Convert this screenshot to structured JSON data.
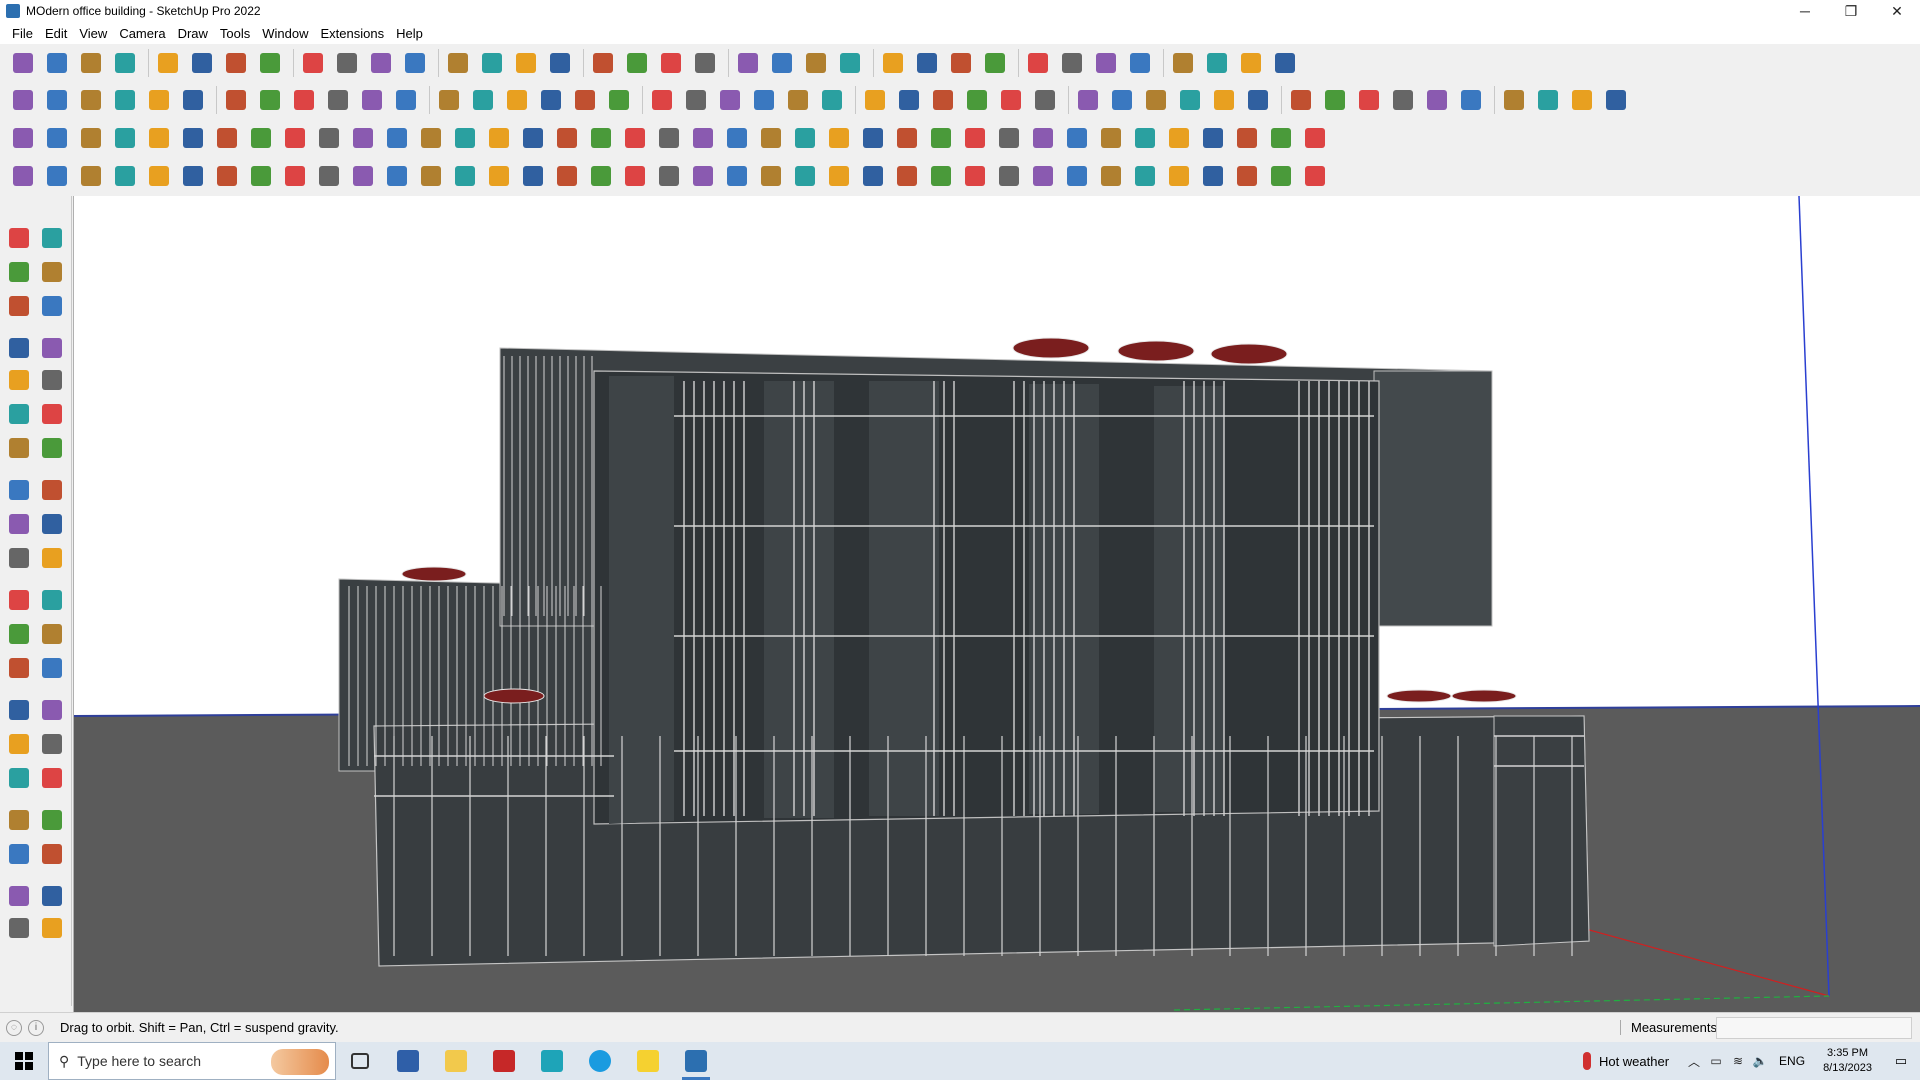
{
  "window": {
    "title": "MOdern office building - SketchUp Pro 2022",
    "minimize": "─",
    "maximize": "❐",
    "close": "✕"
  },
  "menu": [
    "File",
    "Edit",
    "View",
    "Camera",
    "Draw",
    "Tools",
    "Window",
    "Extensions",
    "Help"
  ],
  "status": {
    "hint": "Drag to orbit. Shift = Pan, Ctrl = suspend gravity.",
    "measurements_label": "Measurements",
    "measurements_value": ""
  },
  "taskbar": {
    "search_placeholder": "Type here to search",
    "weather": "Hot weather",
    "language": "ENG",
    "time": "3:35 PM",
    "date": "8/13/2023"
  },
  "colors": {
    "sky": "#ffffff",
    "ground": "#5b5b5b",
    "building": "#3a3f42",
    "umbrella": "#7a1e1e",
    "horizon": "#2f3f9a",
    "axis_blue": "#2a3fd0",
    "axis_red": "#d02020",
    "axis_green": "#20b040",
    "accent": "#3a78c0"
  }
}
